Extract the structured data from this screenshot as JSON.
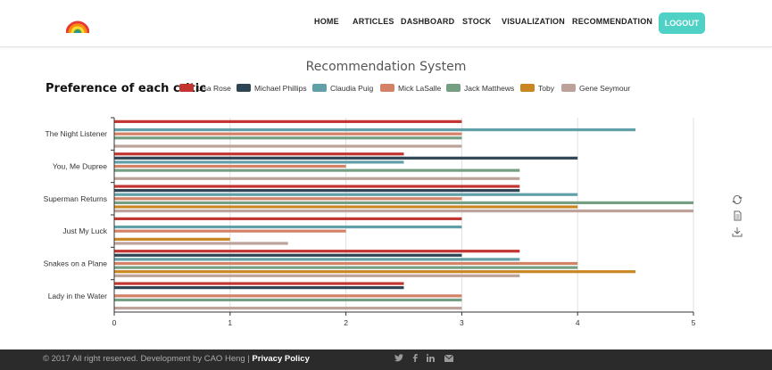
{
  "nav": {
    "items": [
      "HOME",
      "ARTICLES",
      "DASHBOARD",
      "STOCK",
      "VISUALIZATION",
      "RECOMMENDATION"
    ],
    "logout_label": "LOGOUT"
  },
  "page_title": "Recommendation System",
  "footer": {
    "copyright": "© 2017 All right reserved. Development by CAO Heng | ",
    "privacy": "Privacy Policy"
  },
  "colors": {
    "accent": "#4fd1c5",
    "series": [
      "#c23531",
      "#2f4554",
      "#61a0a8",
      "#d48265",
      "#749f83",
      "#ca8622",
      "#bda29a"
    ]
  },
  "chart_data": {
    "type": "bar",
    "orientation": "horizontal",
    "title": "Preference of each critic",
    "categories": [
      "Lady in the Water",
      "Snakes on a Plane",
      "Just My Luck",
      "Superman Returns",
      "You, Me  Dupree",
      "The Night Listener"
    ],
    "xlim": [
      0,
      5
    ],
    "xticks": [
      "0",
      "1",
      "2",
      "3",
      "4",
      "5"
    ],
    "grid": true,
    "legend_position": "top",
    "series": [
      {
        "name": "Lisa Rose",
        "values": [
          2.5,
          3.5,
          3.0,
          3.5,
          2.5,
          3.0
        ]
      },
      {
        "name": "Michael Phillips",
        "values": [
          2.5,
          3.0,
          null,
          3.5,
          4.0,
          null
        ]
      },
      {
        "name": "Claudia Puig",
        "values": [
          null,
          3.5,
          3.0,
          4.0,
          2.5,
          4.5
        ]
      },
      {
        "name": "Mick LaSalle",
        "values": [
          3.0,
          4.0,
          2.0,
          3.0,
          2.0,
          3.0
        ]
      },
      {
        "name": "Jack Matthews",
        "values": [
          3.0,
          4.0,
          null,
          5.0,
          3.5,
          3.0
        ]
      },
      {
        "name": "Toby",
        "values": [
          null,
          4.5,
          1.0,
          4.0,
          null,
          null
        ]
      },
      {
        "name": "Gene Seymour",
        "values": [
          3.0,
          3.5,
          1.5,
          5.0,
          3.5,
          3.0
        ]
      }
    ]
  }
}
